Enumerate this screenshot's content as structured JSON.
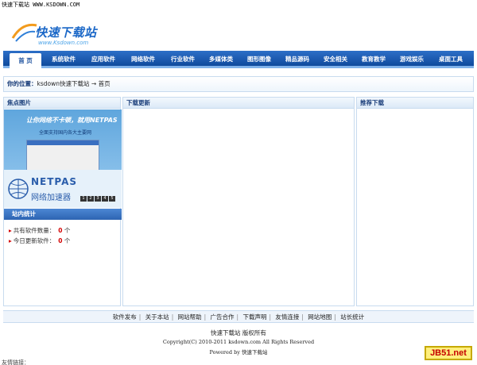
{
  "topbar": {
    "title": "快速下载站 WWW.KSDOWN.COM"
  },
  "logo": {
    "title": "快速下载站",
    "url": "www.Ksdown.com"
  },
  "nav": {
    "items": [
      {
        "label": "首 页"
      },
      {
        "label": "系统软件"
      },
      {
        "label": "应用软件"
      },
      {
        "label": "网络软件"
      },
      {
        "label": "行业软件"
      },
      {
        "label": "多媒体类"
      },
      {
        "label": "图形图像"
      },
      {
        "label": "精品源码"
      },
      {
        "label": "安全相关"
      },
      {
        "label": "教育教学"
      },
      {
        "label": "游戏娱乐"
      },
      {
        "label": "桌面工具"
      }
    ]
  },
  "breadcrumb": {
    "prefix": "你的位置：",
    "site": "ksdown快速下载站",
    "arrow": "→",
    "home": "首页"
  },
  "left": {
    "title": "焦点图片",
    "banner": {
      "line1": "让你网络不卡顿，就用NETPAS",
      "line2": "全面支持国内各大主要网",
      "brand": "NETPAS",
      "brand_cn": "网络加速器",
      "dots": [
        "1",
        "2",
        "3",
        "4",
        "5"
      ]
    },
    "stats_title": "站内统计",
    "stats": [
      {
        "label": "共有软件数量：",
        "value": "0",
        "unit": "个"
      },
      {
        "label": "今日更新软件：",
        "value": "0",
        "unit": "个"
      }
    ]
  },
  "middle": {
    "title": "下载更新"
  },
  "right": {
    "title": "推荐下载"
  },
  "footer": {
    "links": [
      "软件发布",
      "关于本站",
      "网站帮助",
      "广告合作",
      "下载声明",
      "友情连接",
      "网站地图",
      "站长统计"
    ],
    "line1": "快速下载站 版权所有",
    "line2": "Copyright(C) 2010-2011 ksdown.com All Rights Reserved",
    "line3_pre": "Powered by",
    "line3_name": "快速下载站",
    "friends": "友情链接："
  },
  "watermark": "JB51.net",
  "colors": {
    "nav_blue": "#1a5bb3",
    "accent_red": "#d40000",
    "border": "#c8dbef"
  }
}
